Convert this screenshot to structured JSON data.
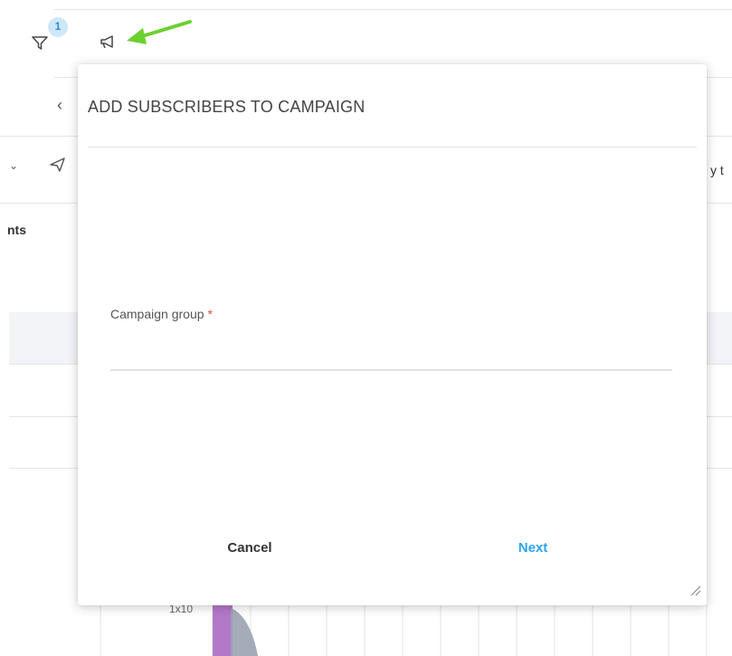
{
  "toolbar": {
    "filter_badge": "1",
    "filter_icon": "filter-icon",
    "campaign_icon": "megaphone-icon",
    "accent": "#2b8fd6"
  },
  "background": {
    "side_text": "nts",
    "right_text": "y t",
    "chart_tick": "1x10"
  },
  "dialog": {
    "title": "ADD SUBSCRIBERS TO CAMPAIGN",
    "field": {
      "label": "Campaign group",
      "required_mark": "*",
      "value": ""
    },
    "cancel_label": "Cancel",
    "next_label": "Next",
    "next_color": "#2aa5f0"
  }
}
